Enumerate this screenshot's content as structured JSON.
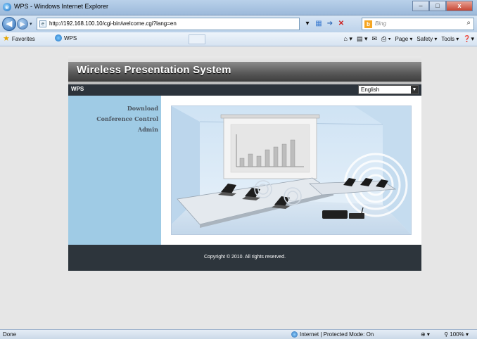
{
  "browser": {
    "title": "WPS - Windows Internet Explorer",
    "url": "http://192.168.100.10/cgi-bin/welcome.cgi?lang=en",
    "search_placeholder": "Bing",
    "favorites_label": "Favorites",
    "tab_label": "WPS",
    "commands": [
      "Page ▾",
      "Safety ▾",
      "Tools ▾"
    ],
    "status_left": "Done",
    "status_zone": "Internet | Protected Mode: On",
    "zoom": "100%"
  },
  "site": {
    "brand": "Wireless Presentation System",
    "section": "WPS",
    "language": {
      "selected": "English"
    },
    "nav": [
      "Download",
      "Conference Control",
      "Admin"
    ],
    "footer": "Copyright © 2010. All rights reserved."
  }
}
